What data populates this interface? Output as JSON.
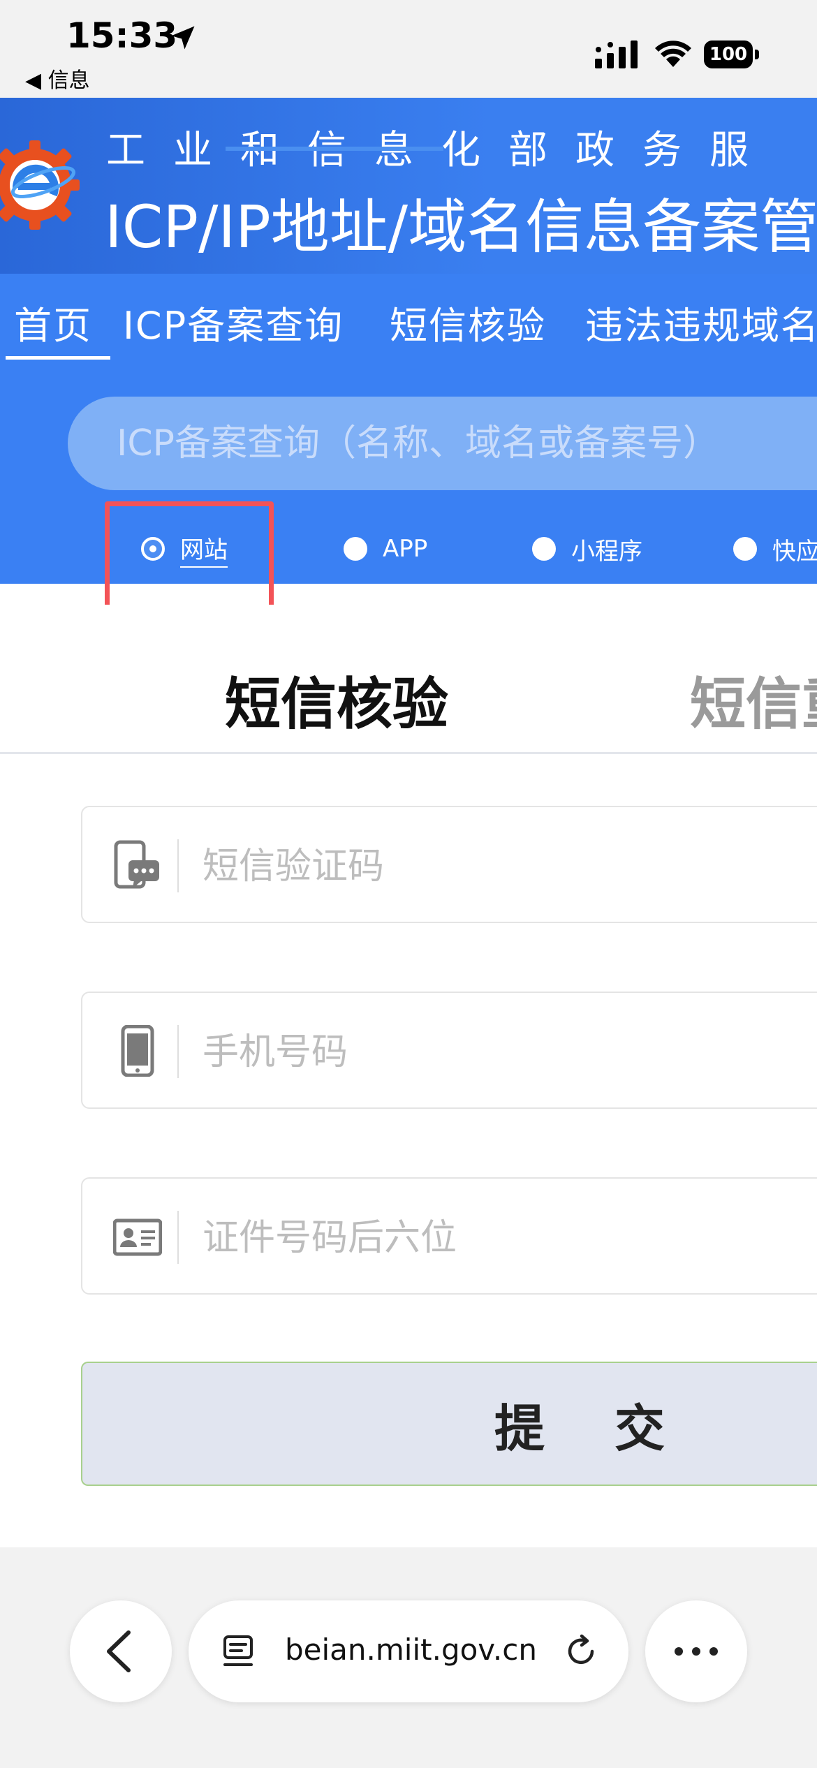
{
  "status_bar": {
    "time": "15:33",
    "back_app_label": "◀ 信息",
    "battery": "100"
  },
  "header": {
    "subtitle": "工业和信息化部政务服",
    "title": "ICP/IP地址/域名信息备案管"
  },
  "nav": {
    "items": [
      {
        "label": "首页",
        "active": true
      },
      {
        "label": "ICP备案查询"
      },
      {
        "label": "短信核验"
      },
      {
        "label": "违法违规域名"
      }
    ]
  },
  "search": {
    "placeholder": "ICP备案查询（名称、域名或备案号）",
    "types": [
      {
        "label": "网站",
        "selected": true
      },
      {
        "label": "APP"
      },
      {
        "label": "小程序"
      },
      {
        "label": "快应用"
      }
    ]
  },
  "tabs": [
    {
      "label": "短信核验",
      "active": true
    },
    {
      "label": "短信重发"
    }
  ],
  "form": {
    "sms_code_placeholder": "短信验证码",
    "phone_placeholder": "手机号码",
    "id_placeholder": "证件号码后六位",
    "submit_label": "提交"
  },
  "browser": {
    "url": "beian.miit.gov.cn"
  },
  "colors": {
    "header_blue": "#2c6fe0",
    "nav_blue": "#3a80f3",
    "highlight_red": "#f35357",
    "tab_accent": "#4a8ff0"
  }
}
